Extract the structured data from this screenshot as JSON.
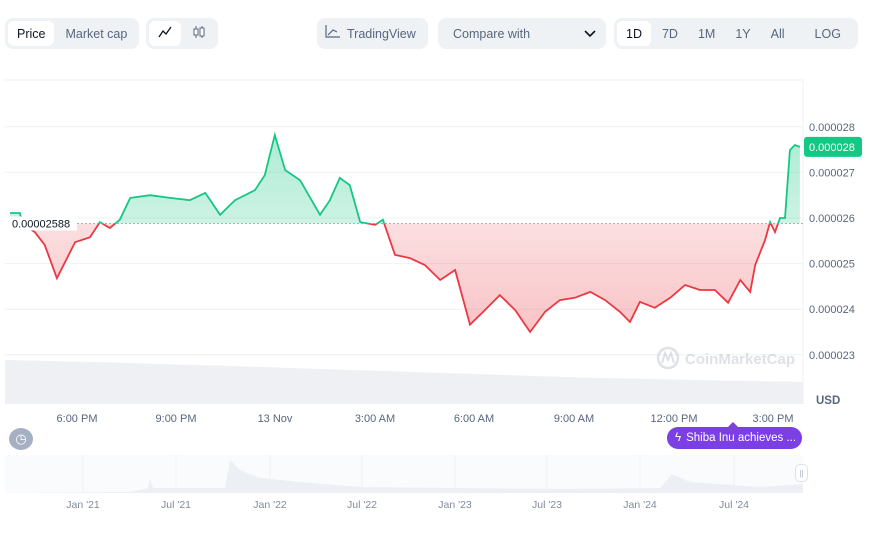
{
  "toolbar": {
    "type_tabs": [
      "Price",
      "Market cap"
    ],
    "type_active": "Price",
    "chart_styles": [
      {
        "name": "line-chart-icon",
        "glyph": "⩘",
        "active": true
      },
      {
        "name": "candlestick-icon",
        "glyph": "♁",
        "active": false
      }
    ],
    "tradingview_label": "TradingView",
    "compare_label": "Compare with",
    "ranges": [
      "1D",
      "7D",
      "1M",
      "1Y",
      "All"
    ],
    "range_active": "1D",
    "log_label": "LOG",
    "more_label": "···"
  },
  "chart_data": {
    "type": "line",
    "currency": "USD",
    "baseline": 2.588e-05,
    "baseline_label": "0.00002588",
    "current_price_label": "0.000028",
    "colors": {
      "up": "#16c784",
      "down": "#ea3943",
      "current_badge": "#16c784"
    },
    "yticks": [
      "0.000028",
      "0.000027",
      "0.000026",
      "0.000025",
      "0.000024",
      "0.000023"
    ],
    "ylim": [
      2.24e-05,
      2.95e-05
    ],
    "xticks": [
      "6:00 PM",
      "9:00 PM",
      "13 Nov",
      "3:00 AM",
      "6:00 AM",
      "9:00 AM",
      "12:00 PM",
      "3:00 PM"
    ],
    "watermark": "CoinMarketCap",
    "points": [
      [
        "12 Nov 16:00",
        2.611e-05
      ],
      [
        "12 Nov 16:18",
        2.611e-05
      ],
      [
        "12 Nov 16:22",
        2.587e-05
      ],
      [
        "12 Nov 16:45",
        2.569e-05
      ],
      [
        "12 Nov 17:03",
        2.541e-05
      ],
      [
        "12 Nov 17:25",
        2.468e-05
      ],
      [
        "12 Nov 17:40",
        2.504e-05
      ],
      [
        "12 Nov 17:58",
        2.547e-05
      ],
      [
        "12 Nov 18:25",
        2.558e-05
      ],
      [
        "12 Nov 18:43",
        2.591e-05
      ],
      [
        "12 Nov 19:01",
        2.578e-05
      ],
      [
        "12 Nov 19:19",
        2.596e-05
      ],
      [
        "12 Nov 19:38",
        2.644e-05
      ],
      [
        "12 Nov 20:14",
        2.65e-05
      ],
      [
        "12 Nov 20:50",
        2.644e-05
      ],
      [
        "12 Nov 21:26",
        2.639e-05
      ],
      [
        "12 Nov 21:54",
        2.655e-05
      ],
      [
        "12 Nov 22:21",
        2.607e-05
      ],
      [
        "12 Nov 22:48",
        2.639e-05
      ],
      [
        "12 Nov 23:24",
        2.661e-05
      ],
      [
        "12 Nov 23:42",
        2.694e-05
      ],
      [
        "13 Nov 00:00",
        2.782e-05
      ],
      [
        "13 Nov 00:19",
        2.705e-05
      ],
      [
        "13 Nov 00:46",
        2.683e-05
      ],
      [
        "13 Nov 01:22",
        2.607e-05
      ],
      [
        "13 Nov 01:40",
        2.639e-05
      ],
      [
        "13 Nov 01:58",
        2.688e-05
      ],
      [
        "13 Nov 02:16",
        2.672e-05
      ],
      [
        "13 Nov 02:35",
        2.591e-05
      ],
      [
        "13 Nov 03:02",
        2.585e-05
      ],
      [
        "13 Nov 03:16",
        2.596e-05
      ],
      [
        "13 Nov 03:38",
        2.519e-05
      ],
      [
        "13 Nov 04:05",
        2.512e-05
      ],
      [
        "13 Nov 04:32",
        2.497e-05
      ],
      [
        "13 Nov 05:00",
        2.464e-05
      ],
      [
        "13 Nov 05:27",
        2.486e-05
      ],
      [
        "13 Nov 05:54",
        2.366e-05
      ],
      [
        "13 Nov 06:21",
        2.398e-05
      ],
      [
        "13 Nov 06:48",
        2.431e-05
      ],
      [
        "13 Nov 07:16",
        2.398e-05
      ],
      [
        "13 Nov 07:43",
        2.35e-05
      ],
      [
        "13 Nov 08:10",
        2.394e-05
      ],
      [
        "13 Nov 08:37",
        2.42e-05
      ],
      [
        "13 Nov 09:04",
        2.425e-05
      ],
      [
        "13 Nov 09:32",
        2.438e-05
      ],
      [
        "13 Nov 09:59",
        2.42e-05
      ],
      [
        "13 Nov 10:26",
        2.394e-05
      ],
      [
        "13 Nov 10:44",
        2.372e-05
      ],
      [
        "13 Nov 11:02",
        2.416e-05
      ],
      [
        "13 Nov 11:29",
        2.403e-05
      ],
      [
        "13 Nov 11:57",
        2.425e-05
      ],
      [
        "13 Nov 12:24",
        2.453e-05
      ],
      [
        "13 Nov 12:51",
        2.442e-05
      ],
      [
        "13 Nov 13:18",
        2.442e-05
      ],
      [
        "13 Nov 13:42",
        2.414e-05
      ],
      [
        "13 Nov 14:04",
        2.464e-05
      ],
      [
        "13 Nov 14:22",
        2.438e-05
      ],
      [
        "13 Nov 14:31",
        2.497e-05
      ],
      [
        "13 Nov 14:49",
        2.552e-05
      ],
      [
        "13 Nov 14:58",
        2.591e-05
      ],
      [
        "13 Nov 15:07",
        2.569e-05
      ],
      [
        "13 Nov 15:16",
        2.6e-05
      ],
      [
        "13 Nov 15:25",
        2.6e-05
      ],
      [
        "13 Nov 15:34",
        2.749e-05
      ],
      [
        "13 Nov 15:43",
        2.76e-05
      ],
      [
        "13 Nov 15:52",
        2.756e-05
      ]
    ]
  },
  "navigator": {
    "xticks": [
      "Jan '21",
      "Jul '21",
      "Jan '22",
      "Jul '22",
      "Jan '23",
      "Jul '23",
      "Jan '24",
      "Jul '24"
    ]
  },
  "news_badge": "Shiba Inu achieves ..."
}
